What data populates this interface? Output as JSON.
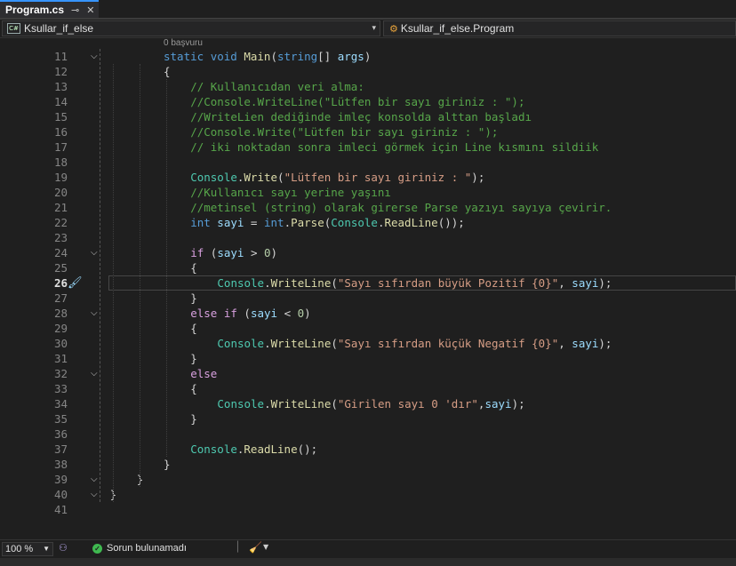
{
  "tab": {
    "title": "Program.cs",
    "pin_icon": "pin-icon",
    "close_icon": "close-icon"
  },
  "nav": {
    "project": "Ksullar_if_else",
    "project_icon_text": "C#",
    "scope": "Ksullar_if_else.Program"
  },
  "codelens": "0 başvuru",
  "lines": [
    {
      "n": "11",
      "html": "<span class=\"kw\">static</span> <span class=\"kw\">void</span> <span class=\"mth\">Main</span>(<span class=\"kw\">string</span>[] <span class=\"var\">args</span>)"
    },
    {
      "n": "12",
      "html": "{"
    },
    {
      "n": "13",
      "html": "<span class=\"cmt\">// Kullanıcıdan veri alma:</span>"
    },
    {
      "n": "14",
      "html": "<span class=\"cmt\">//Console.WriteLine(\"Lütfen bir sayı giriniz : \");</span>"
    },
    {
      "n": "15",
      "html": "<span class=\"cmt\">//WriteLien dediğinde imleç konsolda alttan başladı</span>"
    },
    {
      "n": "16",
      "html": "<span class=\"cmt\">//Console.Write(\"Lütfen bir sayı giriniz : \");</span>"
    },
    {
      "n": "17",
      "html": "<span class=\"cmt\">// iki noktadan sonra imleci görmek için Line kısmını sildiik</span>"
    },
    {
      "n": "18",
      "html": ""
    },
    {
      "n": "19",
      "html": "<span class=\"typ\">Console</span>.<span class=\"mth\">Write</span>(<span class=\"str\">\"Lütfen bir sayı giriniz : \"</span>);"
    },
    {
      "n": "20",
      "html": "<span class=\"cmt\">//Kullanıcı sayı yerine yaşını</span>"
    },
    {
      "n": "21",
      "html": "<span class=\"cmt\">//metinsel (string) olarak girerse Parse yazıyı sayıya çevirir.</span>"
    },
    {
      "n": "22",
      "html": "<span class=\"kw\">int</span> <span class=\"var\">sayi</span> = <span class=\"kw\">int</span>.<span class=\"mth\">Parse</span>(<span class=\"typ\">Console</span>.<span class=\"mth\">ReadLine</span>());"
    },
    {
      "n": "23",
      "html": ""
    },
    {
      "n": "24",
      "html": "<span class=\"ctl\">if</span> (<span class=\"var\">sayi</span> &gt; <span class=\"num\">0</span>)"
    },
    {
      "n": "25",
      "html": "{"
    },
    {
      "n": "26",
      "html": "<span class=\"typ\">Console</span>.<span class=\"mth\">WriteLine</span>(<span class=\"str\">\"Sayı sıfırdan büyük Pozitif {0}\"</span>, <span class=\"var\">sayi</span>);"
    },
    {
      "n": "27",
      "html": "}"
    },
    {
      "n": "28",
      "html": "<span class=\"ctl\">else</span> <span class=\"ctl\">if</span> (<span class=\"var\">sayi</span> &lt; <span class=\"num\">0</span>)"
    },
    {
      "n": "29",
      "html": "{"
    },
    {
      "n": "30",
      "html": "<span class=\"typ\">Console</span>.<span class=\"mth\">WriteLine</span>(<span class=\"str\">\"Sayı sıfırdan küçük Negatif {0}\"</span>, <span class=\"var\">sayi</span>);"
    },
    {
      "n": "31",
      "html": "}"
    },
    {
      "n": "32",
      "html": "<span class=\"ctl\">else</span>"
    },
    {
      "n": "33",
      "html": "{"
    },
    {
      "n": "34",
      "html": "<span class=\"typ\">Console</span>.<span class=\"mth\">WriteLine</span>(<span class=\"str\">\"Girilen sayı 0 'dır\"</span>,<span class=\"var\">sayi</span>);"
    },
    {
      "n": "35",
      "html": "}"
    },
    {
      "n": "36",
      "html": ""
    },
    {
      "n": "37",
      "html": "<span class=\"typ\">Console</span>.<span class=\"mth\">ReadLine</span>();"
    },
    {
      "n": "38",
      "html": "}"
    },
    {
      "n": "39",
      "html": "}"
    },
    {
      "n": "40",
      "html": "}"
    },
    {
      "n": "41",
      "html": ""
    }
  ],
  "status": {
    "zoom": "100 %",
    "message": "Sorun bulunamadı"
  }
}
